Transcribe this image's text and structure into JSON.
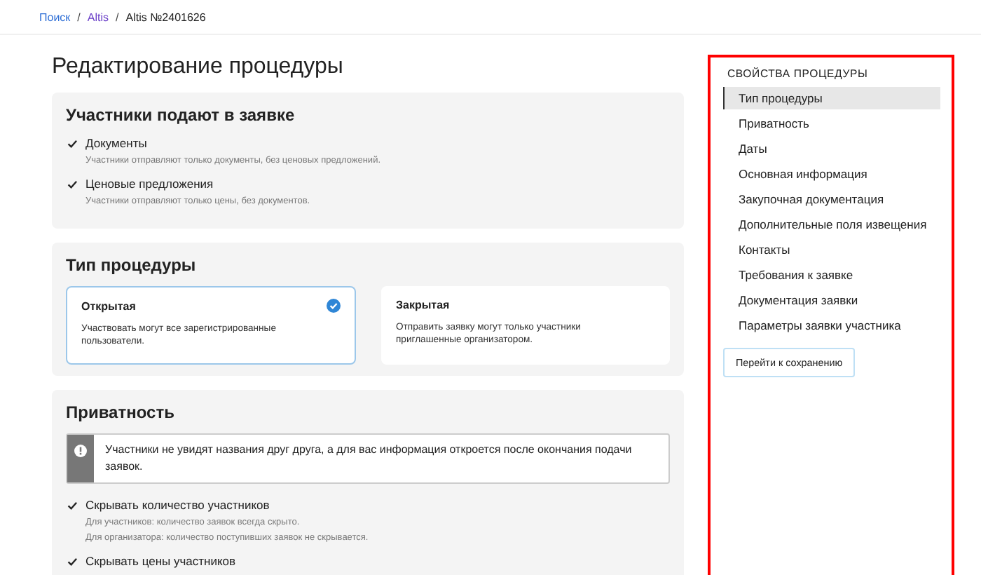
{
  "breadcrumb": [
    {
      "label": "Поиск",
      "kind": "link",
      "color": "#2f6fd6"
    },
    {
      "label": "Altis",
      "kind": "link",
      "color": "#6a3fc8",
      "separator": "/"
    },
    {
      "label": "Altis №2401626",
      "kind": "current",
      "separator": "/"
    }
  ],
  "page_title": "Редактирование процедуры",
  "sections": [
    {
      "title": "Участники подают в заявке",
      "items": [
        {
          "kind": "checkbox",
          "label": "Документы",
          "checked": true,
          "hints": [
            "Участники отправляют только документы, без ценовых предложений."
          ]
        },
        {
          "kind": "checkbox",
          "label": "Ценовые предложения",
          "checked": true,
          "hints": [
            "Участники отправляют только цены, без документов."
          ]
        }
      ]
    },
    {
      "title": "Тип процедуры",
      "items": [
        {
          "kind": "options",
          "options": [
            {
              "title": "Открытая",
              "description": "Участвовать могут все зарегистрированные пользователи.",
              "selected": true
            },
            {
              "title": "Закрытая",
              "description": "Отправить заявку могут только участники приглашенные организатором.",
              "selected": false
            }
          ]
        }
      ]
    },
    {
      "title": "Приватность",
      "items": [
        {
          "kind": "notice",
          "text": "Участники не увидят названия друг друга, а для вас информация откроется после окончания подачи заявок."
        },
        {
          "kind": "checkbox",
          "label": "Скрывать количество участников",
          "checked": true,
          "hints": [
            "Для участников: количество заявок всегда скрыто.",
            "Для организатора: количество поступивших заявок не скрывается."
          ]
        },
        {
          "kind": "checkbox",
          "label": "Скрывать цены участников",
          "checked": true
        }
      ]
    }
  ],
  "sidebar": {
    "title": "СВОЙСТВА ПРОЦЕДУРЫ",
    "items": [
      {
        "label": "Тип процедуры",
        "selected": true
      },
      {
        "label": "Приватность",
        "selected": false
      },
      {
        "label": "Даты",
        "selected": false
      },
      {
        "label": "Основная информация",
        "selected": false
      },
      {
        "label": "Закупочная документация",
        "selected": false
      },
      {
        "label": "Дополнительные поля извещения",
        "selected": false
      },
      {
        "label": "Контакты",
        "selected": false
      },
      {
        "label": "Требования к заявке",
        "selected": false
      },
      {
        "label": "Документация заявки",
        "selected": false
      },
      {
        "label": "Параметры заявки участника",
        "selected": false
      }
    ],
    "button": "Перейти к сохранению"
  }
}
